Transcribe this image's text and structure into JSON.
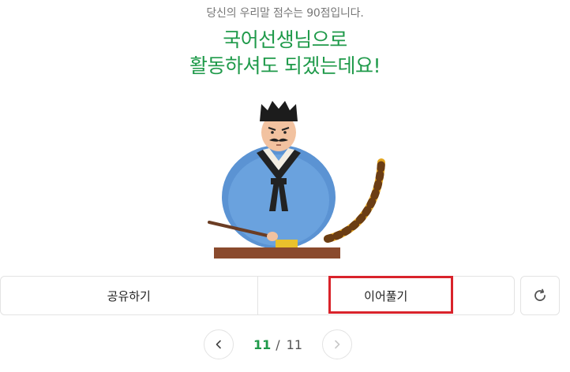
{
  "result": {
    "score_text": "당신의 우리말 점수는 90점입니다.",
    "headline_line1": "국어선생님으로",
    "headline_line2": "활동하셔도 되겠는데요!"
  },
  "actions": {
    "share_label": "공유하기",
    "continue_label": "이어풀기",
    "refresh_icon": "refresh-icon"
  },
  "pagination": {
    "current": "11",
    "separator": "/",
    "total": "11",
    "prev_icon": "chevron-left-icon",
    "next_icon": "chevron-right-icon"
  },
  "colors": {
    "accent_green": "#1f9a4a",
    "highlight_red": "#d9232b"
  }
}
